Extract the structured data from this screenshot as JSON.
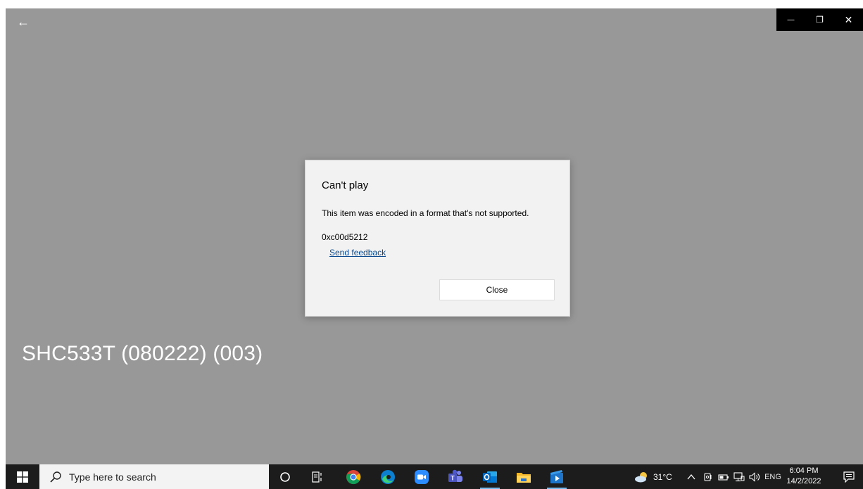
{
  "app": {
    "back_glyph": "←",
    "minimize_glyph": "—",
    "restore_glyph": "❐",
    "close_glyph": "✕",
    "video_title": "SHC533T (080222) (003)",
    "background_color": "#989898"
  },
  "dialog": {
    "title": "Can't play",
    "message": "This item was encoded in a format that's not supported.",
    "error_code": "0xc00d5212",
    "feedback_link": "Send feedback",
    "close_label": "Close"
  },
  "taskbar": {
    "search_placeholder": "Type here to search",
    "pinned_icons": [
      "cortana-icon",
      "task-view-icon",
      "chrome-icon",
      "edge-icon",
      "zoom-icon",
      "teams-icon",
      "outlook-icon",
      "file-explorer-icon",
      "movies-tv-icon"
    ],
    "weather_temp": "31°C",
    "language": "ENG",
    "time": "6:04 PM",
    "date": "14/2/2022",
    "accent_color": "#76b9ed"
  }
}
